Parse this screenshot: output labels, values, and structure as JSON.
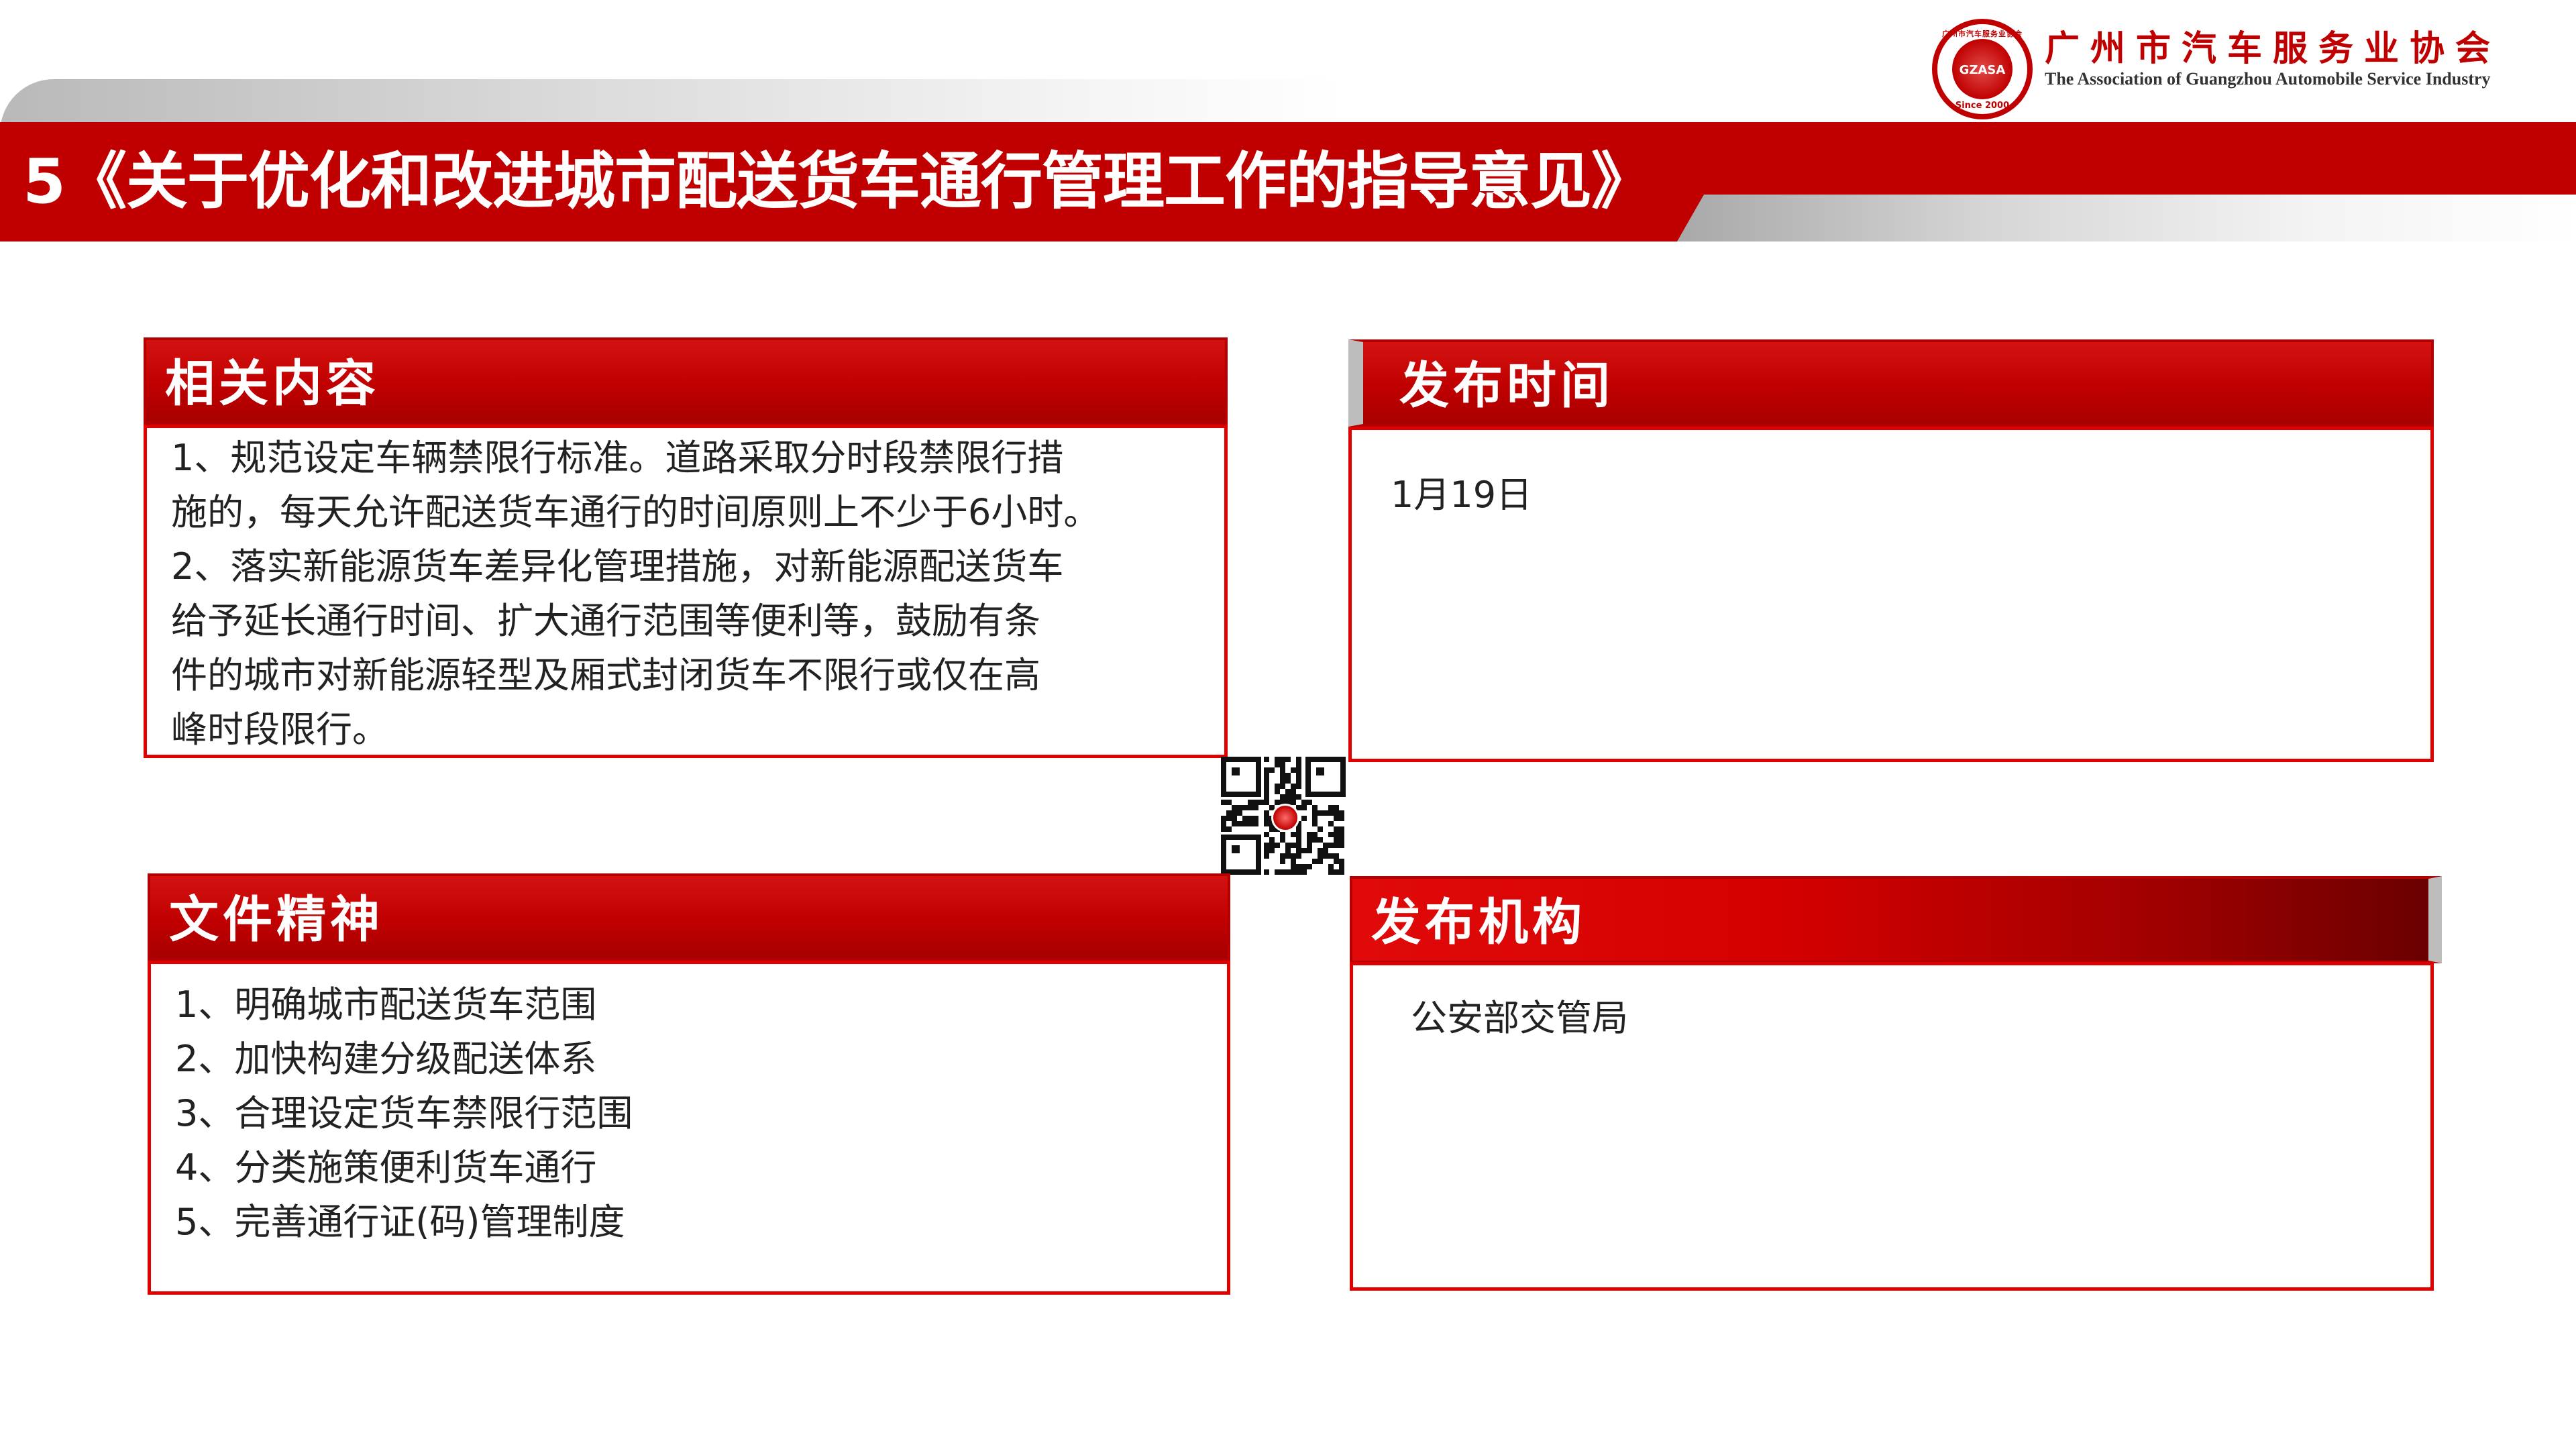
{
  "header": {
    "title": "5《关于优化和改进城市配送货车通行管理工作的指导意见》"
  },
  "logo": {
    "cn_name": "广州市汽车服务业协会",
    "en_name": "The Association of Guangzhou Automobile Service Industry",
    "seal_top": "广州市汽车服务业协会",
    "seal_mid": "GZASA",
    "seal_bottom": "Since 2000"
  },
  "panels": {
    "related": {
      "title": "相关内容",
      "lines": [
        "1、规范设定车辆禁限行标准。道路采取分时段禁限行措",
        "施的，每天允许配送货车通行的时间原则上不少于6小时。",
        "2、落实新能源货车差异化管理措施，对新能源配送货车",
        "给予延长通行时间、扩大通行范围等便利等，鼓励有条",
        "件的城市对新能源轻型及厢式封闭货车不限行或仅在高",
        "峰时段限行。"
      ]
    },
    "time": {
      "title": "发布时间",
      "value": "1月19日"
    },
    "spirit": {
      "title": "文件精神",
      "lines": [
        "1、明确城市配送货车范围",
        "2、加快构建分级配送体系",
        "3、合理设定货车禁限行范围",
        "4、分类施策便利货车通行",
        "5、完善通行证(码)管理制度"
      ]
    },
    "org": {
      "title": "发布机构",
      "value": "公安部交管局"
    }
  },
  "colors": {
    "brand_red": "#c00000",
    "border_red": "#e00000",
    "accent_gray": "#bdbdbd"
  }
}
